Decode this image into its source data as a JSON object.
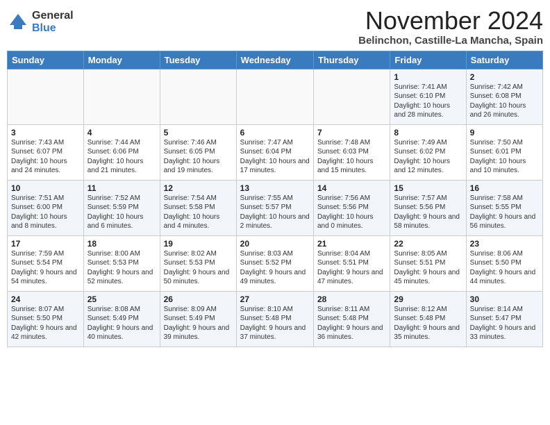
{
  "logo": {
    "general": "General",
    "blue": "Blue"
  },
  "title": "November 2024",
  "location": "Belinchon, Castille-La Mancha, Spain",
  "days_of_week": [
    "Sunday",
    "Monday",
    "Tuesday",
    "Wednesday",
    "Thursday",
    "Friday",
    "Saturday"
  ],
  "weeks": [
    [
      {
        "day": "",
        "info": ""
      },
      {
        "day": "",
        "info": ""
      },
      {
        "day": "",
        "info": ""
      },
      {
        "day": "",
        "info": ""
      },
      {
        "day": "",
        "info": ""
      },
      {
        "day": "1",
        "info": "Sunrise: 7:41 AM\nSunset: 6:10 PM\nDaylight: 10 hours and 28 minutes."
      },
      {
        "day": "2",
        "info": "Sunrise: 7:42 AM\nSunset: 6:08 PM\nDaylight: 10 hours and 26 minutes."
      }
    ],
    [
      {
        "day": "3",
        "info": "Sunrise: 7:43 AM\nSunset: 6:07 PM\nDaylight: 10 hours and 24 minutes."
      },
      {
        "day": "4",
        "info": "Sunrise: 7:44 AM\nSunset: 6:06 PM\nDaylight: 10 hours and 21 minutes."
      },
      {
        "day": "5",
        "info": "Sunrise: 7:46 AM\nSunset: 6:05 PM\nDaylight: 10 hours and 19 minutes."
      },
      {
        "day": "6",
        "info": "Sunrise: 7:47 AM\nSunset: 6:04 PM\nDaylight: 10 hours and 17 minutes."
      },
      {
        "day": "7",
        "info": "Sunrise: 7:48 AM\nSunset: 6:03 PM\nDaylight: 10 hours and 15 minutes."
      },
      {
        "day": "8",
        "info": "Sunrise: 7:49 AM\nSunset: 6:02 PM\nDaylight: 10 hours and 12 minutes."
      },
      {
        "day": "9",
        "info": "Sunrise: 7:50 AM\nSunset: 6:01 PM\nDaylight: 10 hours and 10 minutes."
      }
    ],
    [
      {
        "day": "10",
        "info": "Sunrise: 7:51 AM\nSunset: 6:00 PM\nDaylight: 10 hours and 8 minutes."
      },
      {
        "day": "11",
        "info": "Sunrise: 7:52 AM\nSunset: 5:59 PM\nDaylight: 10 hours and 6 minutes."
      },
      {
        "day": "12",
        "info": "Sunrise: 7:54 AM\nSunset: 5:58 PM\nDaylight: 10 hours and 4 minutes."
      },
      {
        "day": "13",
        "info": "Sunrise: 7:55 AM\nSunset: 5:57 PM\nDaylight: 10 hours and 2 minutes."
      },
      {
        "day": "14",
        "info": "Sunrise: 7:56 AM\nSunset: 5:56 PM\nDaylight: 10 hours and 0 minutes."
      },
      {
        "day": "15",
        "info": "Sunrise: 7:57 AM\nSunset: 5:56 PM\nDaylight: 9 hours and 58 minutes."
      },
      {
        "day": "16",
        "info": "Sunrise: 7:58 AM\nSunset: 5:55 PM\nDaylight: 9 hours and 56 minutes."
      }
    ],
    [
      {
        "day": "17",
        "info": "Sunrise: 7:59 AM\nSunset: 5:54 PM\nDaylight: 9 hours and 54 minutes."
      },
      {
        "day": "18",
        "info": "Sunrise: 8:00 AM\nSunset: 5:53 PM\nDaylight: 9 hours and 52 minutes."
      },
      {
        "day": "19",
        "info": "Sunrise: 8:02 AM\nSunset: 5:53 PM\nDaylight: 9 hours and 50 minutes."
      },
      {
        "day": "20",
        "info": "Sunrise: 8:03 AM\nSunset: 5:52 PM\nDaylight: 9 hours and 49 minutes."
      },
      {
        "day": "21",
        "info": "Sunrise: 8:04 AM\nSunset: 5:51 PM\nDaylight: 9 hours and 47 minutes."
      },
      {
        "day": "22",
        "info": "Sunrise: 8:05 AM\nSunset: 5:51 PM\nDaylight: 9 hours and 45 minutes."
      },
      {
        "day": "23",
        "info": "Sunrise: 8:06 AM\nSunset: 5:50 PM\nDaylight: 9 hours and 44 minutes."
      }
    ],
    [
      {
        "day": "24",
        "info": "Sunrise: 8:07 AM\nSunset: 5:50 PM\nDaylight: 9 hours and 42 minutes."
      },
      {
        "day": "25",
        "info": "Sunrise: 8:08 AM\nSunset: 5:49 PM\nDaylight: 9 hours and 40 minutes."
      },
      {
        "day": "26",
        "info": "Sunrise: 8:09 AM\nSunset: 5:49 PM\nDaylight: 9 hours and 39 minutes."
      },
      {
        "day": "27",
        "info": "Sunrise: 8:10 AM\nSunset: 5:48 PM\nDaylight: 9 hours and 37 minutes."
      },
      {
        "day": "28",
        "info": "Sunrise: 8:11 AM\nSunset: 5:48 PM\nDaylight: 9 hours and 36 minutes."
      },
      {
        "day": "29",
        "info": "Sunrise: 8:12 AM\nSunset: 5:48 PM\nDaylight: 9 hours and 35 minutes."
      },
      {
        "day": "30",
        "info": "Sunrise: 8:14 AM\nSunset: 5:47 PM\nDaylight: 9 hours and 33 minutes."
      }
    ]
  ]
}
